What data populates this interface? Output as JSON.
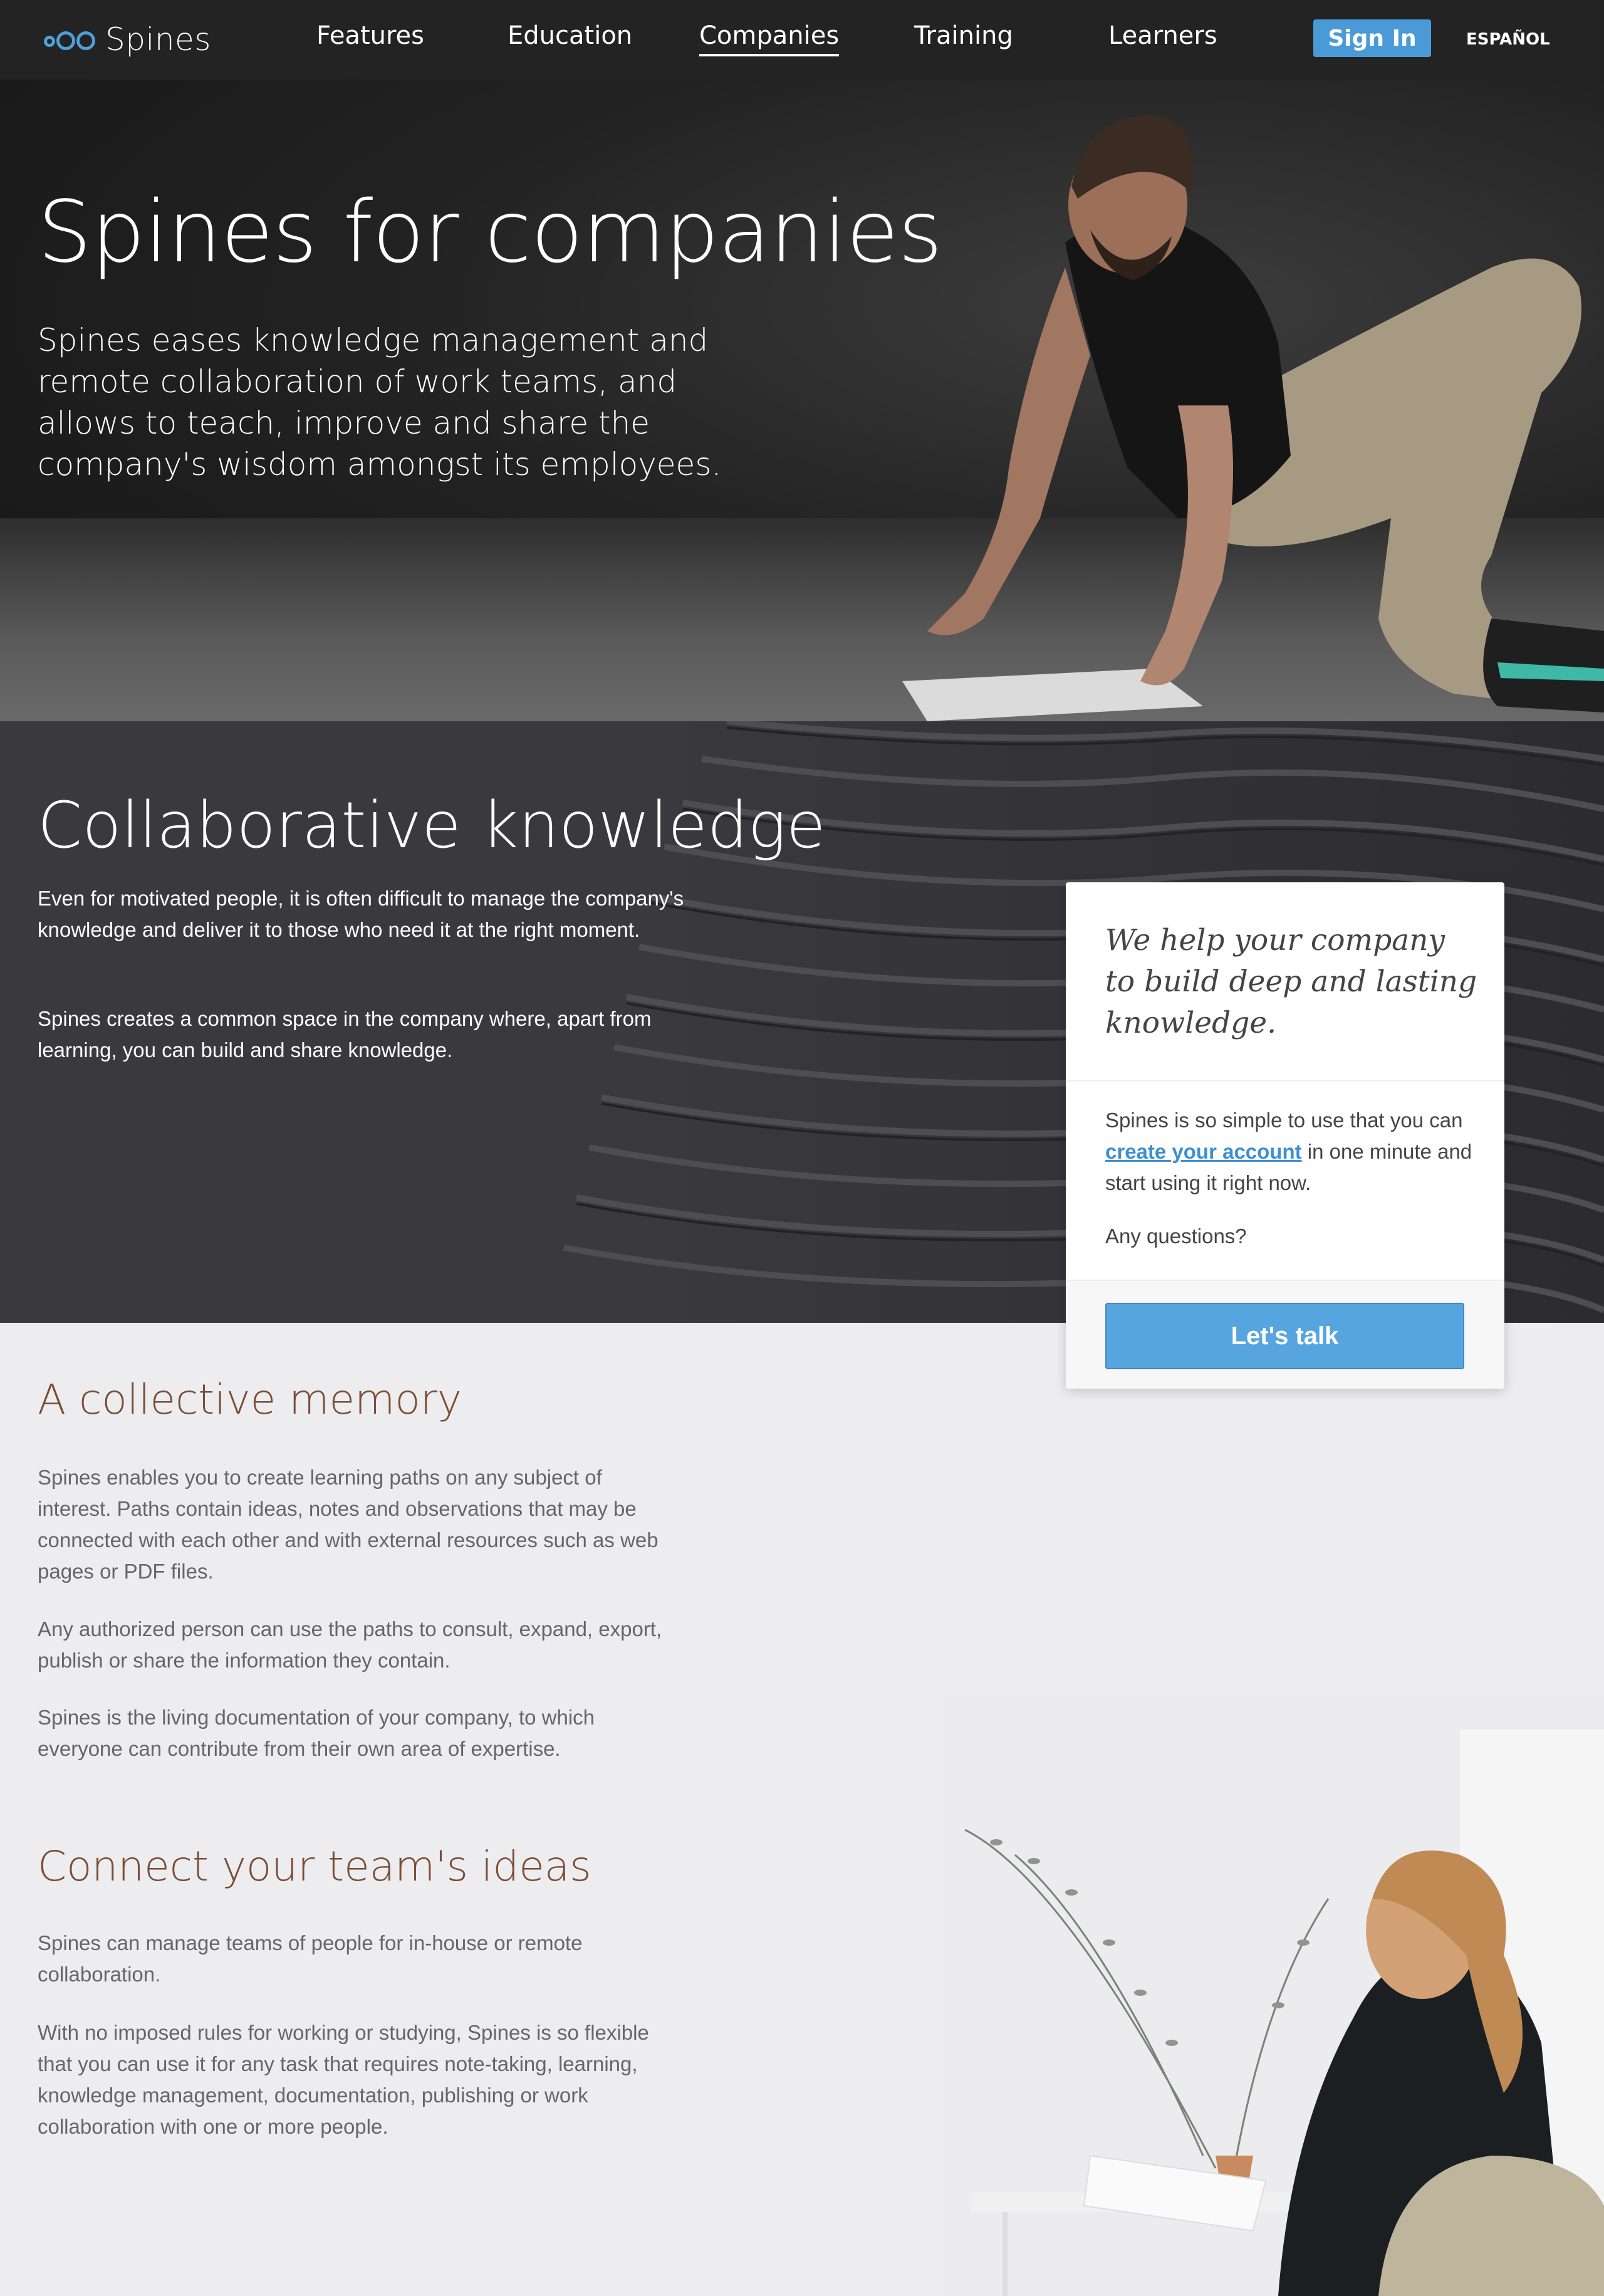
{
  "nav": {
    "logo_text": "Spines",
    "links": [
      {
        "label": "Features"
      },
      {
        "label": "Education"
      },
      {
        "label": "Companies"
      },
      {
        "label": "Training"
      },
      {
        "label": "Learners"
      }
    ],
    "signin_label": "Sign In",
    "language_label": "ESPAÑOL"
  },
  "hero": {
    "title": "Spines for companies",
    "description": "Spines eases knowledge management and remote collaboration of work teams, and allows to teach, improve and share the company's wisdom amongst its employees."
  },
  "collab": {
    "title": "Collaborative knowledge",
    "paragraphs": [
      "Even for motivated people, it is often difficult to manage the company's knowledge and deliver it to those who need it at the right moment.",
      "Spines creates a common space in the company where, apart from learning, you can build and share knowledge."
    ]
  },
  "card": {
    "quote": "We help your company to build deep and lasting knowledge.",
    "text_before": "Spines is so simple to use that you can ",
    "link": "create your account",
    "text_after": " in one minute and start using it right now.",
    "questions": "Any questions?",
    "button": "Let's talk"
  },
  "memory": {
    "title": "A collective memory",
    "paragraphs": [
      "Spines enables you to create learning paths on any subject of interest. Paths contain ideas, notes and observations that may be connected with each other and with external resources such as web pages or PDF files.",
      "Any authorized person can use the paths to consult, expand, export, publish or share the information they contain.",
      "Spines is the living documentation of your company, to which everyone can contribute from their own area of expertise."
    ]
  },
  "team": {
    "title": "Connect your team's ideas",
    "paragraphs": [
      "Spines can manage teams of people for in-house or remote collaboration.",
      "With no imposed rules for working or studying, Spines is so flexible that you can use it for any task that requires note-taking, learning, knowledge management, documentation, publishing or work collaboration with one or more people."
    ]
  },
  "colors": {
    "accent": "#4a9ad8",
    "nav_bg": "#232323",
    "heading_brown": "#7a4d36"
  }
}
